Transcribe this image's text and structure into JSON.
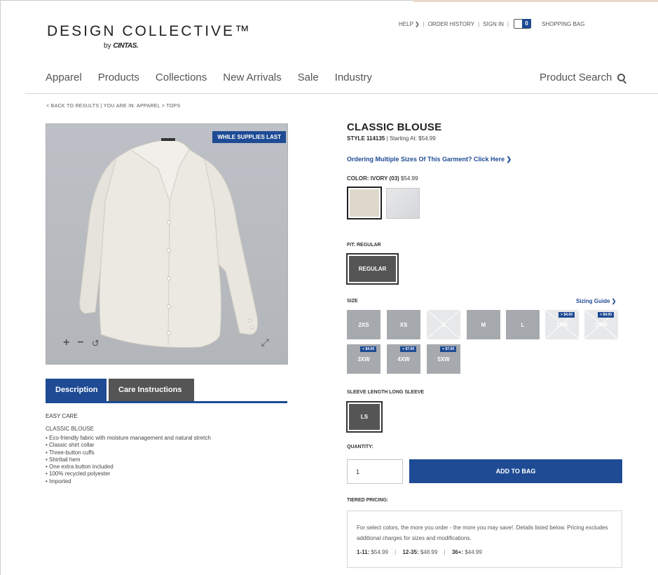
{
  "header": {
    "logo_main": "DESIGN COLLECTIVE™",
    "logo_by": "by",
    "logo_brand": "CINTAS.",
    "util": {
      "help": "HELP",
      "order_history": "ORDER HISTORY",
      "sign_in": "SIGN IN",
      "bag_count": "0",
      "shopping_bag": "SHOPPING BAG"
    }
  },
  "nav": {
    "items": [
      "Apparel",
      "Products",
      "Collections",
      "New Arrivals",
      "Sale",
      "Industry"
    ],
    "search": "Product Search"
  },
  "breadcrumb": "< BACK TO RESULTS  |  YOU ARE IN: APPAREL > TOPS",
  "image": {
    "badge": "WHILE SUPPLIES LAST",
    "zoom_in": "+",
    "zoom_out": "−",
    "reset": "↺",
    "expand": "⤢"
  },
  "tabs": {
    "description": "Description",
    "care": "Care Instructions"
  },
  "description": {
    "heading": "EASY CARE",
    "title": "CLASSIC BLOUSE",
    "bullets": [
      "Eco-friendly fabric with moisture management and natural stretch",
      "Classic shirt collar",
      "Three-button cuffs",
      "Shirttail hem",
      "One extra button included",
      "100% recycled polyester",
      "Imported"
    ]
  },
  "product": {
    "title": "CLASSIC BLOUSE",
    "style_label": "STYLE 114135",
    "starting": "Starting At: $54.99",
    "multi_link": "Ordering Multiple Sizes Of This Garment? Click Here ❯",
    "color_label": "COLOR: IVORY (03)",
    "color_price": "$54.99",
    "colors": {
      "selected": "#ded8cc",
      "other": "#e0e1e4"
    },
    "fit_label": "FIT: REGULAR",
    "fit_option": "REGULAR",
    "size_label": "SIZE",
    "sizing_guide": "Sizing Guide ❯",
    "sizes": [
      {
        "label": "2XS",
        "available": true,
        "upcharge": ""
      },
      {
        "label": "XS",
        "available": true,
        "upcharge": ""
      },
      {
        "label": "S",
        "available": false,
        "upcharge": ""
      },
      {
        "label": "M",
        "available": true,
        "upcharge": ""
      },
      {
        "label": "L",
        "available": true,
        "upcharge": ""
      },
      {
        "label": "1XW",
        "available": false,
        "upcharge": "+ $4.00"
      },
      {
        "label": "2XW",
        "available": false,
        "upcharge": "+ $4.00"
      },
      {
        "label": "3XW",
        "available": true,
        "upcharge": "+ $4.00"
      },
      {
        "label": "4XW",
        "available": true,
        "upcharge": "+ $7.00"
      },
      {
        "label": "5XW",
        "available": true,
        "upcharge": "+ $7.00"
      }
    ],
    "sleeve_label": "SLEEVE LENGTH LONG SLEEVE",
    "sleeve_option": "LS",
    "quantity_label": "QUANTITY:",
    "quantity_value": "1",
    "add_to_bag": "ADD TO BAG",
    "tier_label": "TIERED PRICING:",
    "tier_text": "For select colors, the more you order - the more you may save!. Details listed below. Pricing excludes additional charges for sizes and modifications.",
    "tiers": [
      {
        "range": "1-11:",
        "price": "$54.99"
      },
      {
        "range": "12-35:",
        "price": "$48.99"
      },
      {
        "range": "36+:",
        "price": "$44.99"
      }
    ]
  },
  "colors": {
    "brand_blue": "#1e4b94",
    "dark_gray": "#555555"
  }
}
